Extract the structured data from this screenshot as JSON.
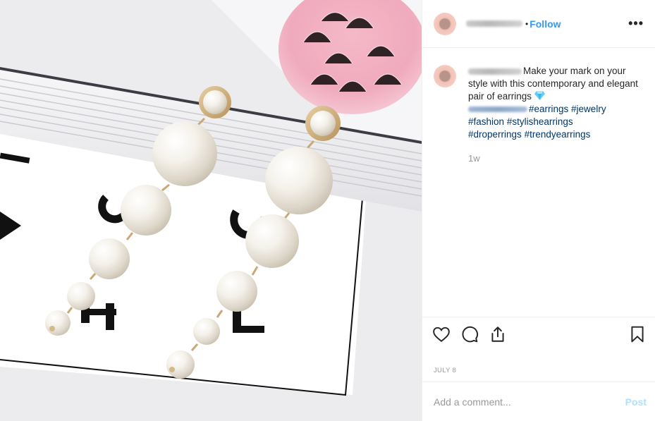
{
  "photo": {
    "alt": ""
  },
  "header": {
    "follow_label": "Follow",
    "more_label": "•••"
  },
  "caption": {
    "text": "Make your mark on your style with this contemporary and elegant pair of earrings",
    "hashtags": [
      "#earrings",
      "#jewelry",
      "#fashion",
      "#stylishearrings",
      "#droperrings",
      "#trendyearrings"
    ],
    "time_ago": "1w"
  },
  "actions": {
    "like_icon": "heart-icon",
    "comment_icon": "comment-icon",
    "share_icon": "share-icon",
    "save_icon": "bookmark-icon"
  },
  "post_date": "JULY 8",
  "comment": {
    "placeholder": "Add a comment...",
    "post_label": "Post"
  },
  "colors": {
    "link": "#3897f0",
    "hashtag": "#003569",
    "muted": "#999999",
    "post_disabled": "#b2dffc"
  }
}
